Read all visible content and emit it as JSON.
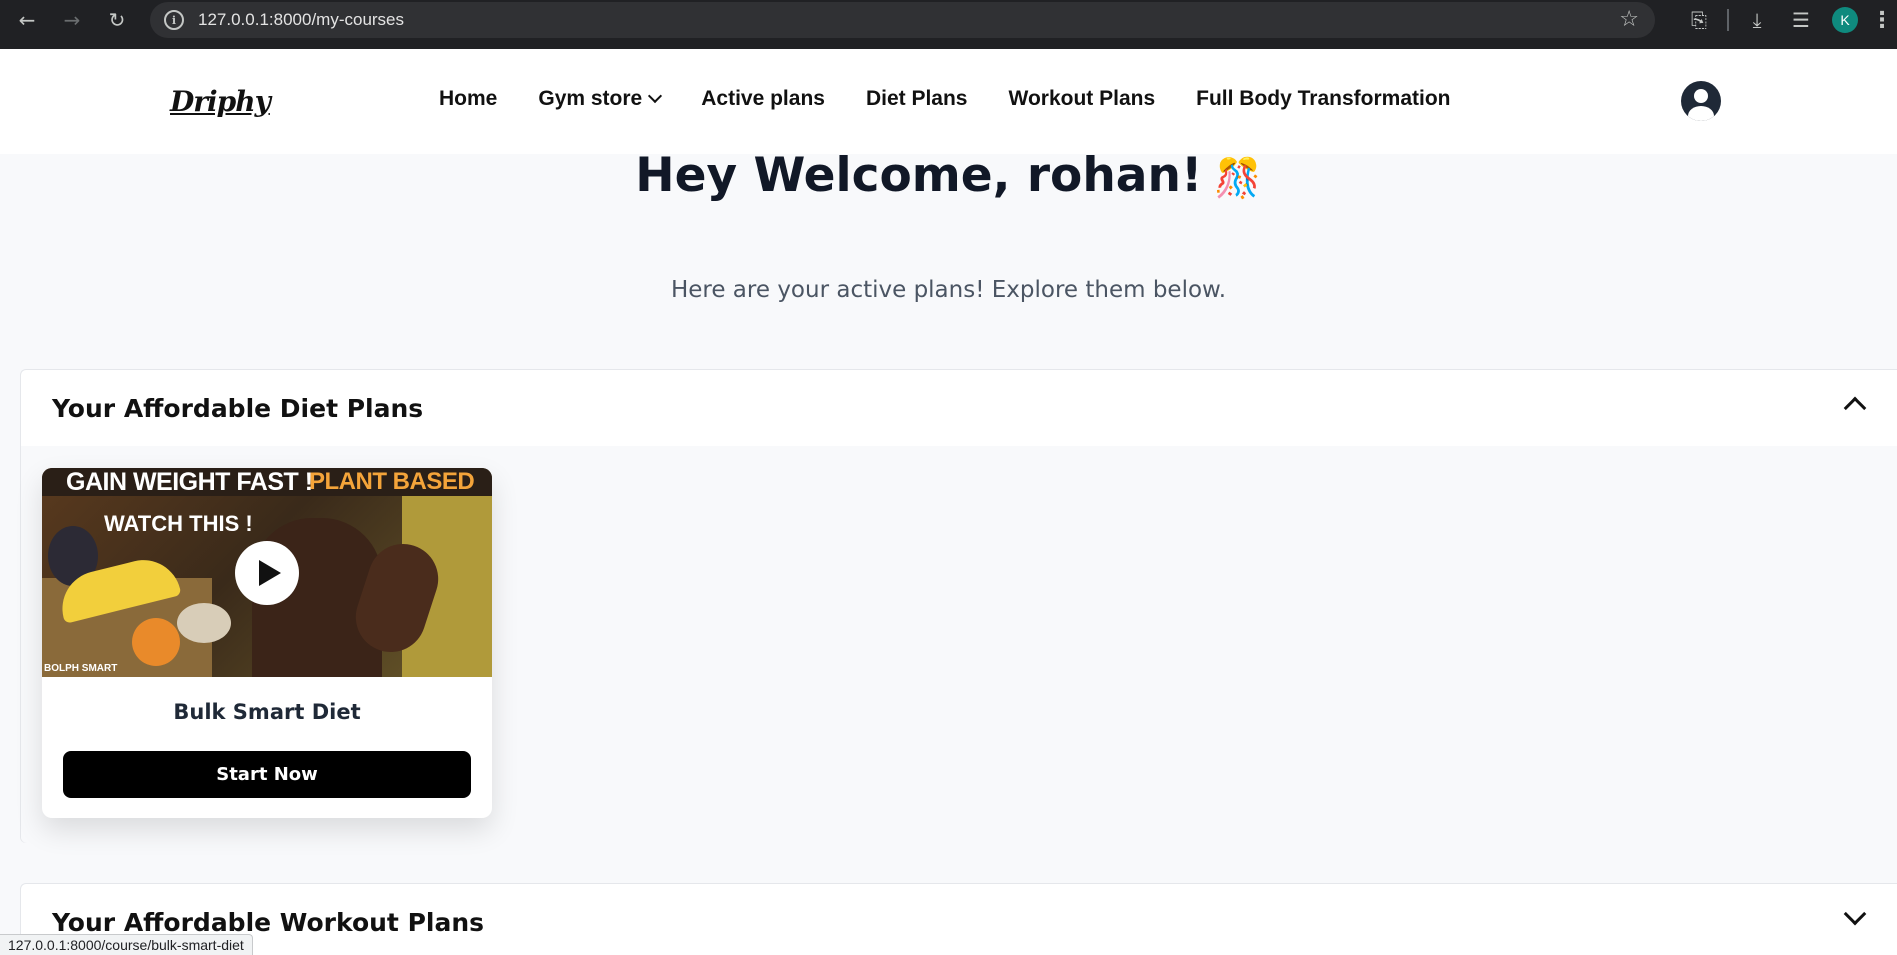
{
  "browser": {
    "url": "127.0.0.1:8000/my-courses",
    "profile_initial": "K",
    "status_url": "127.0.0.1:8000/course/bulk-smart-diet"
  },
  "header": {
    "logo": "Driphy",
    "nav": [
      {
        "label": "Home"
      },
      {
        "label": "Gym store",
        "has_dropdown": true
      },
      {
        "label": "Active plans"
      },
      {
        "label": "Diet Plans"
      },
      {
        "label": "Workout Plans"
      },
      {
        "label": "Full Body Transformation"
      }
    ],
    "user_icon": "user-circle-icon"
  },
  "hero": {
    "title": "Hey Welcome, rohan!",
    "emoji": "🎊",
    "subtitle": "Here are your active plans! Explore them below."
  },
  "sections": [
    {
      "title": "Your Affordable Diet Plans",
      "expanded": true,
      "cards": [
        {
          "title": "Bulk Smart Diet",
          "button": "Start Now",
          "thumbnail": {
            "line1_white": "GAIN WEIGHT FAST !",
            "line1_orange": "PLANT BASED",
            "line2": "WATCH THIS !",
            "watermark": "BOLPH SMART"
          }
        }
      ]
    },
    {
      "title": "Your Affordable Workout Plans",
      "expanded": false,
      "cards": []
    }
  ],
  "colors": {
    "chrome_bg": "#202124",
    "page_bg": "#f8f9fb",
    "text_dark": "#111827",
    "button_bg": "#000000",
    "avatar_bg": "#0f8a7e"
  }
}
